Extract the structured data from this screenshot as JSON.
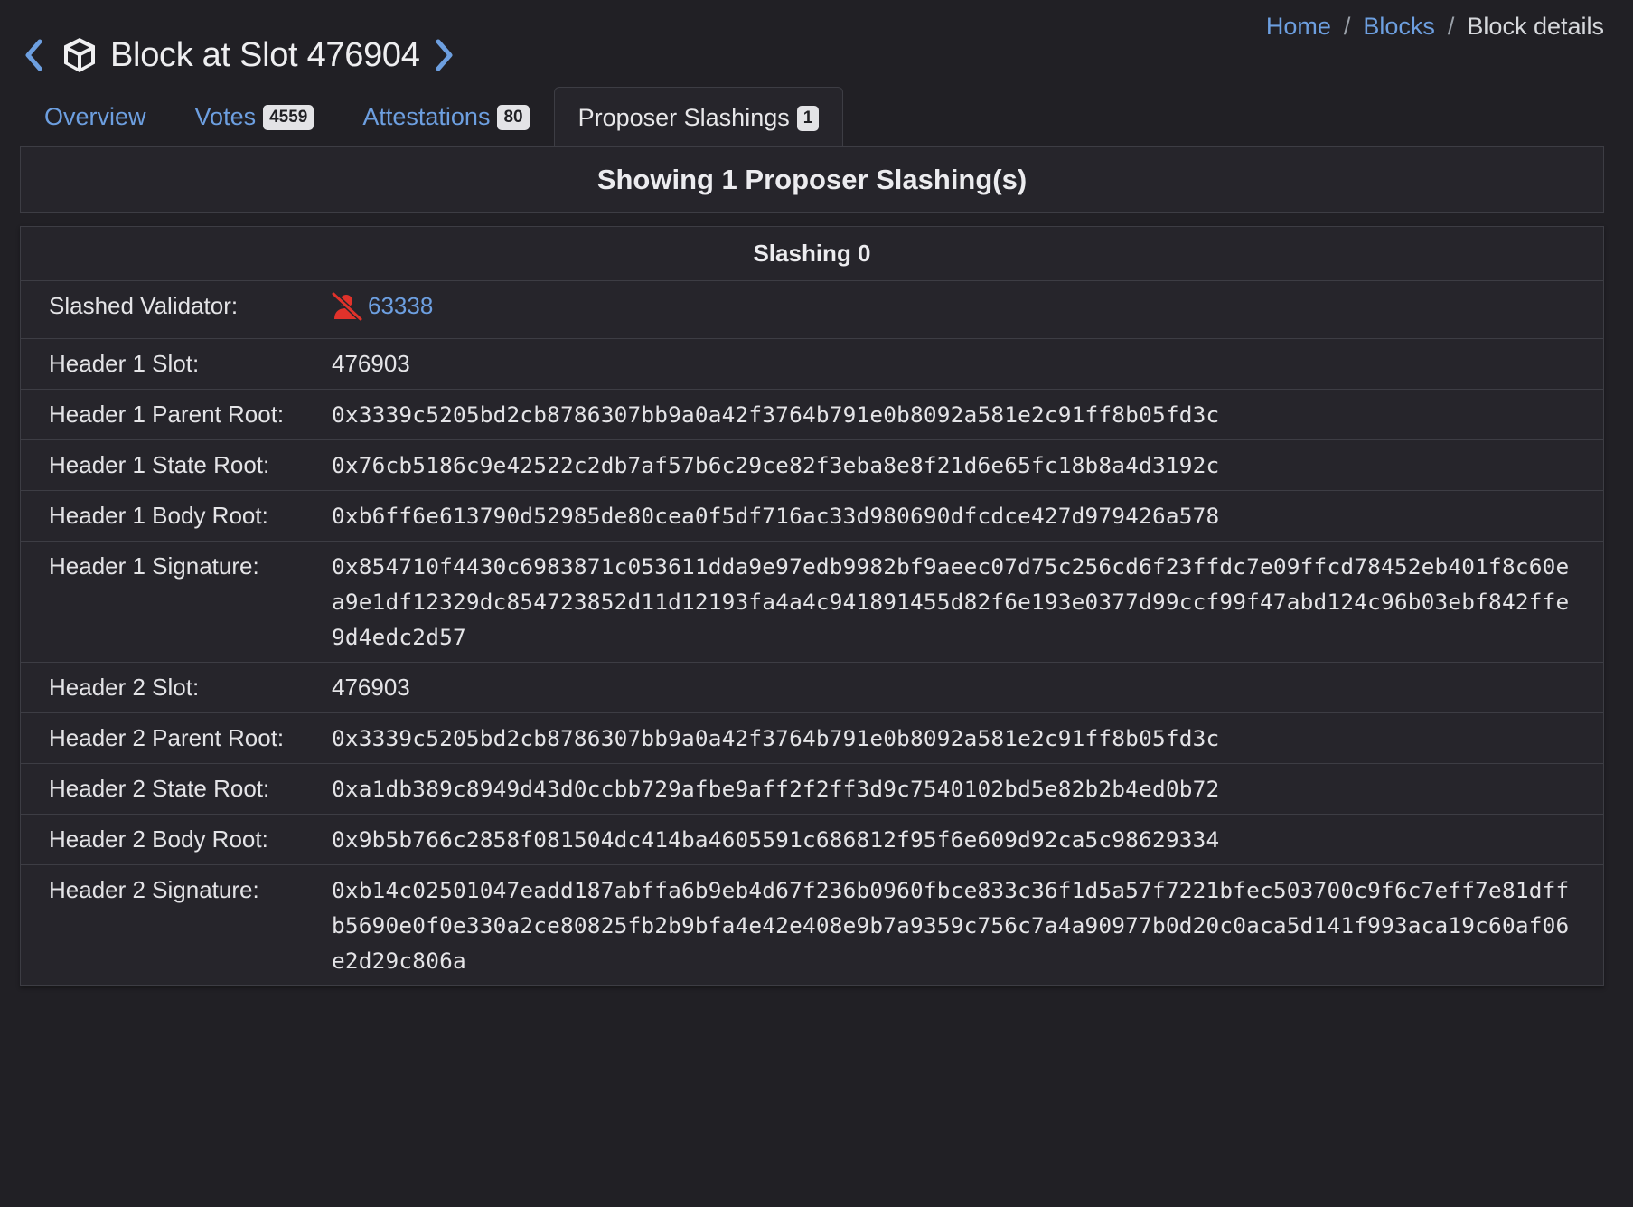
{
  "breadcrumb": {
    "home": "Home",
    "blocks": "Blocks",
    "current": "Block details",
    "separator": "/"
  },
  "header": {
    "title": "Block at Slot 476904",
    "icon": "cube-icon",
    "prev_icon": "chevron-left-icon",
    "next_icon": "chevron-right-icon"
  },
  "tabs": [
    {
      "label": "Overview",
      "badge": null
    },
    {
      "label": "Votes",
      "badge": "4559"
    },
    {
      "label": "Attestations",
      "badge": "80"
    },
    {
      "label": "Proposer Slashings",
      "badge": "1",
      "active": true
    }
  ],
  "summary": {
    "title": "Showing 1 Proposer Slashing(s)"
  },
  "slashing": {
    "title": "Slashing 0",
    "validator": {
      "label": "Slashed Validator:",
      "value": "63338",
      "icon": "slashed-validator-icon"
    },
    "rows": [
      {
        "label": "Header 1 Slot:",
        "value": "476903",
        "mono": false
      },
      {
        "label": "Header 1 Parent Root:",
        "value": "0x3339c5205bd2cb8786307bb9a0a42f3764b791e0b8092a581e2c91ff8b05fd3c",
        "mono": true
      },
      {
        "label": "Header 1 State Root:",
        "value": "0x76cb5186c9e42522c2db7af57b6c29ce82f3eba8e8f21d6e65fc18b8a4d3192c",
        "mono": true
      },
      {
        "label": "Header 1 Body Root:",
        "value": "0xb6ff6e613790d52985de80cea0f5df716ac33d980690dfcdce427d979426a578",
        "mono": true
      },
      {
        "label": "Header 1 Signature:",
        "value": "0x854710f4430c6983871c053611dda9e97edb9982bf9aeec07d75c256cd6f23ffdc7e09ffcd78452eb401f8c60ea9e1df12329dc854723852d11d12193fa4a4c941891455d82f6e193e0377d99ccf99f47abd124c96b03ebf842ffe9d4edc2d57",
        "mono": true
      },
      {
        "label": "Header 2 Slot:",
        "value": "476903",
        "mono": false
      },
      {
        "label": "Header 2 Parent Root:",
        "value": "0x3339c5205bd2cb8786307bb9a0a42f3764b791e0b8092a581e2c91ff8b05fd3c",
        "mono": true
      },
      {
        "label": "Header 2 State Root:",
        "value": "0xa1db389c8949d43d0ccbb729afbe9aff2f2ff3d9c7540102bd5e82b2b4ed0b72",
        "mono": true
      },
      {
        "label": "Header 2 Body Root:",
        "value": "0x9b5b766c2858f081504dc414ba4605591c686812f95f6e609d92ca5c98629334",
        "mono": true
      },
      {
        "label": "Header 2 Signature:",
        "value": "0xb14c02501047eadd187abffa6b9eb4d67f236b0960fbce833c36f1d5a57f7221bfec503700c9f6c7eff7e81dffb5690e0f0e330a2ce80825fb2b9bfa4e42e408e9b7a9359c756c7a4a90977b0d20c0aca5d141f993aca19c60af06e2d29c806a",
        "mono": true
      }
    ]
  },
  "colors": {
    "background": "#212025",
    "card": "#26252b",
    "border": "#3d3d44",
    "link": "#6d9fe0",
    "slashed_icon": "#e0322b"
  }
}
